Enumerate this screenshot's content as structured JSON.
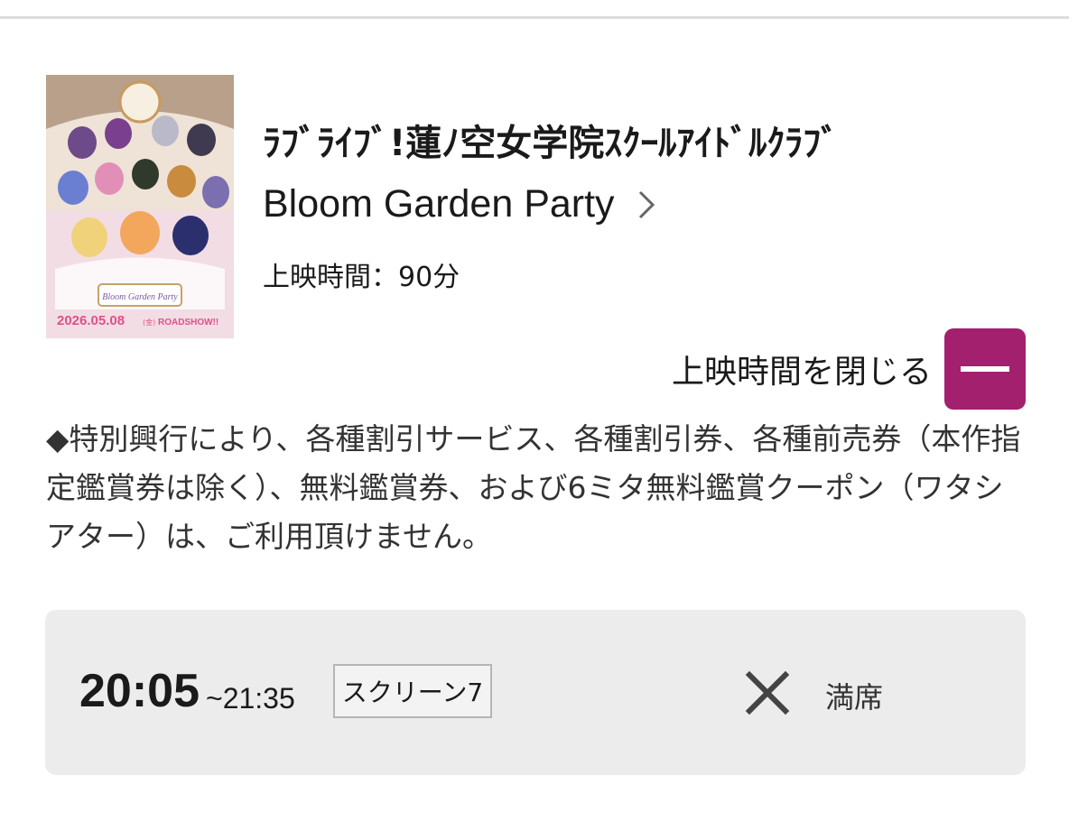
{
  "movie": {
    "title_line1": "ﾗﾌﾞﾗｲﾌﾞ!蓮ﾉ空女学院ｽｸｰﾙｱｲﾄﾞﾙｸﾗﾌﾞ",
    "title_line2": "Bloom Garden Party",
    "runtime": "上映時間：90分",
    "poster": {
      "date_text": "2026.05.08",
      "day_text": "(金)",
      "roadshow_text": "ROADSHOW!!",
      "logo_text": "Bloom Garden Party"
    }
  },
  "toggle": {
    "label": "上映時間を閉じる"
  },
  "notice": {
    "text": "◆特別興行により、各種割引サービス、各種割引券、各種前売券（本作指定鑑賞券は除く）、無料鑑賞券、および6ミタ無料鑑賞クーポン（ワタシアター）は、ご利用頂けません。"
  },
  "showtime": {
    "start": "20:05",
    "end": "~21:35",
    "screen": "スクリーン7",
    "status": "満席",
    "status_icon": "cross-icon"
  },
  "colors": {
    "accent": "#a3206f",
    "card_bg": "#ececec"
  }
}
